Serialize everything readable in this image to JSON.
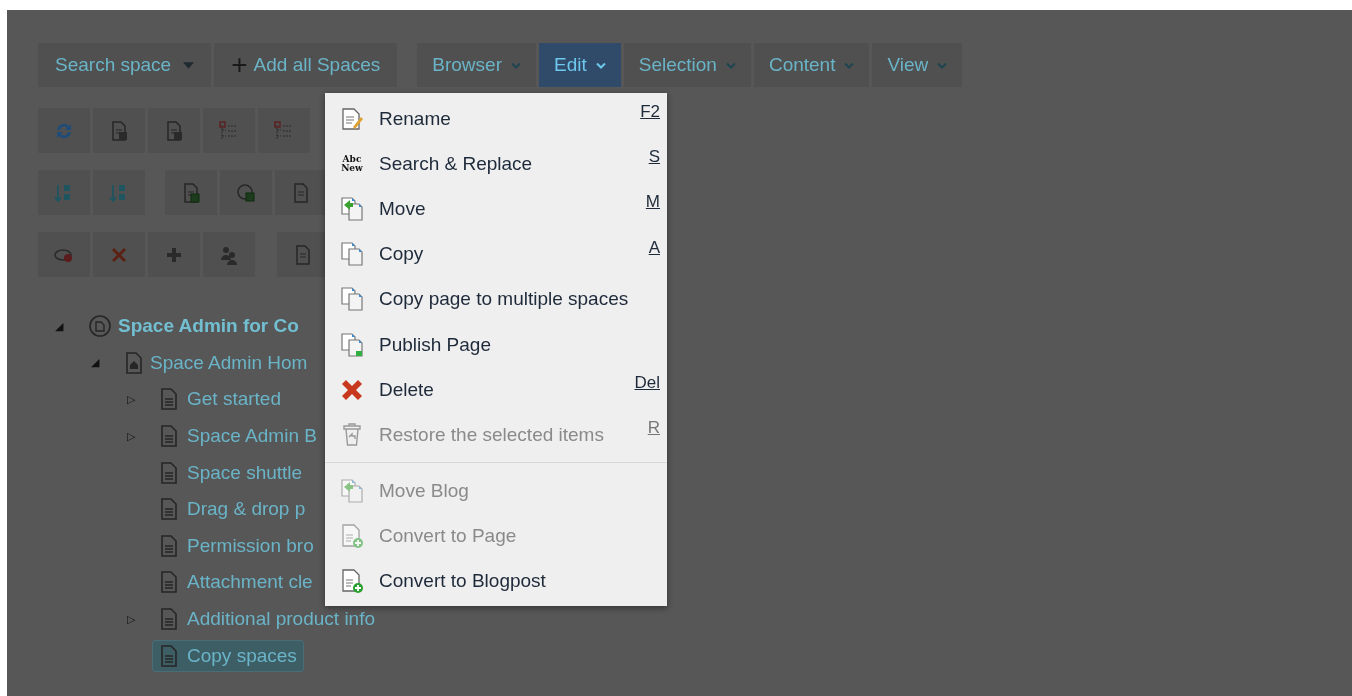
{
  "search": {
    "label": "Search space"
  },
  "add_button": {
    "icon": "+",
    "label": "Add all Spaces"
  },
  "menubar": [
    {
      "label": "Browser",
      "selected": false
    },
    {
      "label": "Edit",
      "selected": true
    },
    {
      "label": "Selection",
      "selected": false
    },
    {
      "label": "Content",
      "selected": false
    },
    {
      "label": "View",
      "selected": false
    }
  ],
  "tree": [
    {
      "label": "Space Admin for Co",
      "kind": "space",
      "toggle": "◢",
      "selected": false,
      "children": [
        {
          "label": "Space Admin Hom",
          "kind": "home",
          "toggle": "◢",
          "selected": false,
          "children": [
            {
              "label": "Get started",
              "kind": "page",
              "toggle": "▷",
              "selected": false
            },
            {
              "label": "Space Admin B",
              "kind": "page",
              "toggle": "▷",
              "selected": false
            },
            {
              "label": "Space shuttle",
              "kind": "page",
              "selected": false
            },
            {
              "label": "Drag & drop p",
              "kind": "page",
              "selected": false
            },
            {
              "label": "Permission bro",
              "kind": "page",
              "selected": false
            },
            {
              "label": "Attachment cle",
              "kind": "page",
              "selected": false
            },
            {
              "label": "Additional product info",
              "kind": "page",
              "toggle": "▷",
              "selected": false
            },
            {
              "label": "Copy spaces",
              "kind": "page",
              "selected": true
            }
          ]
        }
      ]
    }
  ],
  "edit_menu": {
    "groups": [
      [
        {
          "label": "Rename",
          "kind": "rename",
          "shortcut": "F2",
          "disabled": false
        },
        {
          "label": "Search & Replace",
          "kind": "replace",
          "icon_text": "Abc New",
          "shortcut": "S",
          "disabled": false
        },
        {
          "label": "Move",
          "kind": "move",
          "shortcut": "M",
          "disabled": false
        },
        {
          "label": "Copy",
          "kind": "copy",
          "shortcut": "A",
          "disabled": false
        },
        {
          "label": "Copy page to multiple spaces",
          "kind": "copy",
          "disabled": false
        },
        {
          "label": "Publish Page",
          "kind": "publish",
          "disabled": false
        },
        {
          "label": "Delete",
          "kind": "delete",
          "shortcut": "Del",
          "disabled": false
        },
        {
          "label": "Restore the selected items",
          "kind": "restore",
          "shortcut": "R",
          "disabled": true
        }
      ],
      [
        {
          "label": "Move Blog",
          "kind": "move",
          "disabled": true
        },
        {
          "label": "Convert to Page",
          "kind": "convert",
          "disabled": true
        },
        {
          "label": "Convert to Blogpost",
          "kind": "convert",
          "disabled": false
        }
      ]
    ]
  }
}
